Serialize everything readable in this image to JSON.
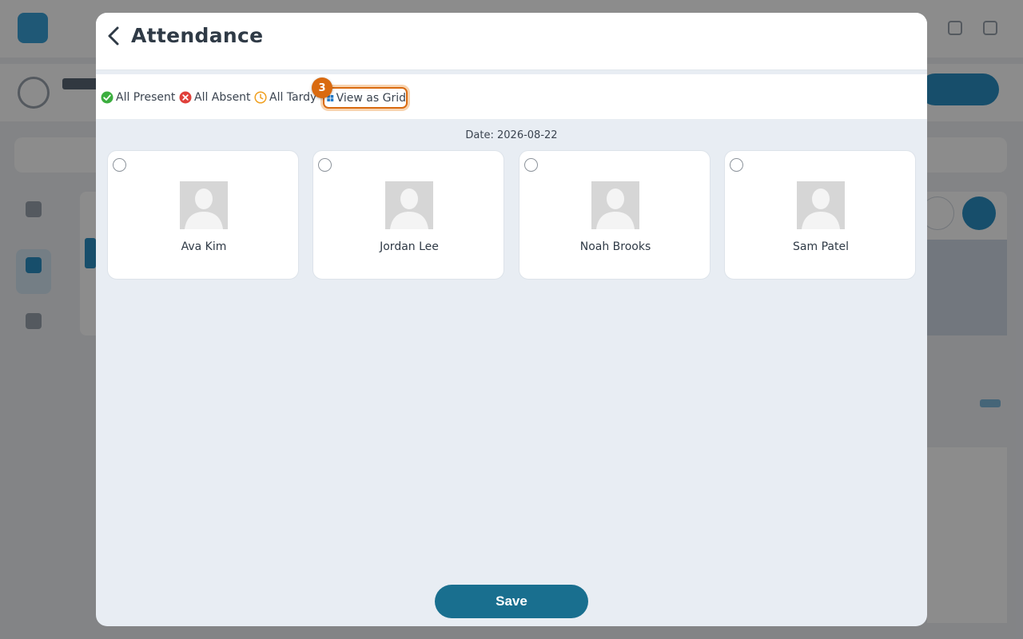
{
  "modal": {
    "title": "Attendance",
    "toolbar": {
      "all_present": "All Present",
      "all_absent": "All Absent",
      "all_tardy": "All Tardy",
      "view_as_grid": "View as Grid",
      "step_badge": "3"
    },
    "date_label": "Date: 2026-08-22",
    "students": [
      {
        "name": "Ava Kim",
        "selected": false
      },
      {
        "name": "Jordan Lee",
        "selected": false
      },
      {
        "name": "Noah Brooks",
        "selected": false
      },
      {
        "name": "Sam Patel",
        "selected": false
      }
    ],
    "save_label": "Save"
  },
  "icons": {
    "back": "chevron-left-icon",
    "present": "check-circle-icon",
    "absent": "x-circle-icon",
    "tardy": "clock-icon",
    "grid": "grid-icon",
    "avatar": "person-placeholder-icon"
  },
  "colors": {
    "present": "#3cae3f",
    "absent": "#e0403a",
    "tardy": "#f0a020",
    "highlight": "#d96a10",
    "primary": "#196f8f"
  }
}
